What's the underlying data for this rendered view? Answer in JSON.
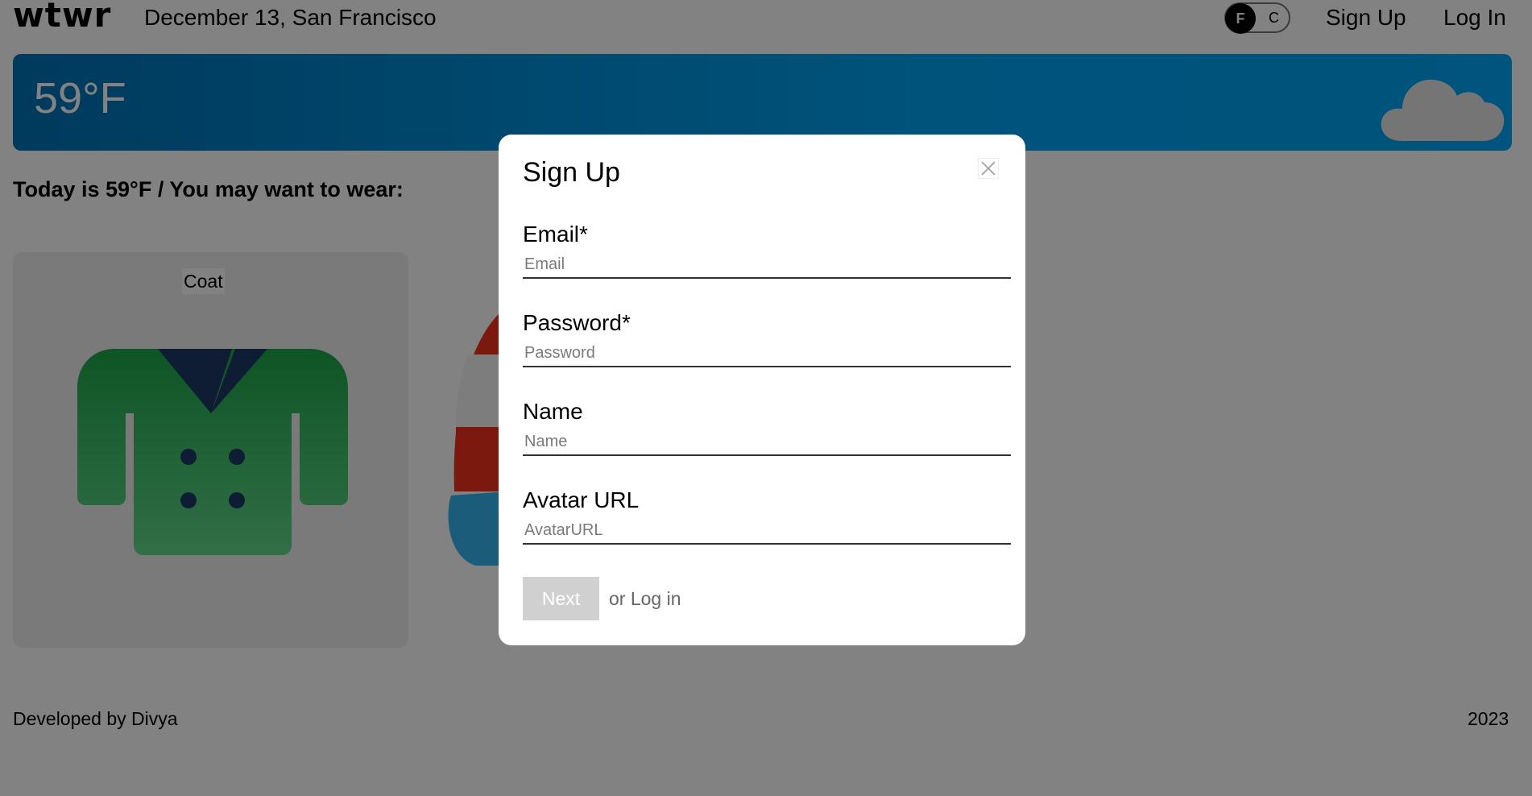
{
  "header": {
    "logo": "wtwr",
    "logo_mark": "°",
    "date_location": "December 13, San Francisco",
    "toggle": {
      "active": "F",
      "inactive": "C"
    },
    "signup_label": "Sign Up",
    "login_label": "Log In"
  },
  "weather": {
    "temperature": "59°F",
    "condition_icon": "cloud-icon",
    "colors": {
      "start": "#0073b7",
      "end": "#00a6f5"
    }
  },
  "main": {
    "today_text": "Today is 59°F / You may want to wear:",
    "cards": [
      {
        "label": "Coat",
        "icon": "coat-icon"
      }
    ]
  },
  "footer": {
    "developer": "Developed by Divya",
    "year": "2023"
  },
  "modal": {
    "title": "Sign Up",
    "close_icon": "close-icon",
    "fields": {
      "email": {
        "label": "Email*",
        "placeholder": "Email",
        "value": ""
      },
      "password": {
        "label": "Password*",
        "placeholder": "Password",
        "value": ""
      },
      "name": {
        "label": "Name",
        "placeholder": "Name",
        "value": ""
      },
      "avatar": {
        "label": "Avatar URL",
        "placeholder": "AvatarURL",
        "value": ""
      }
    },
    "next_label": "Next",
    "alt_prefix": "or",
    "alt_link": "Log in"
  }
}
